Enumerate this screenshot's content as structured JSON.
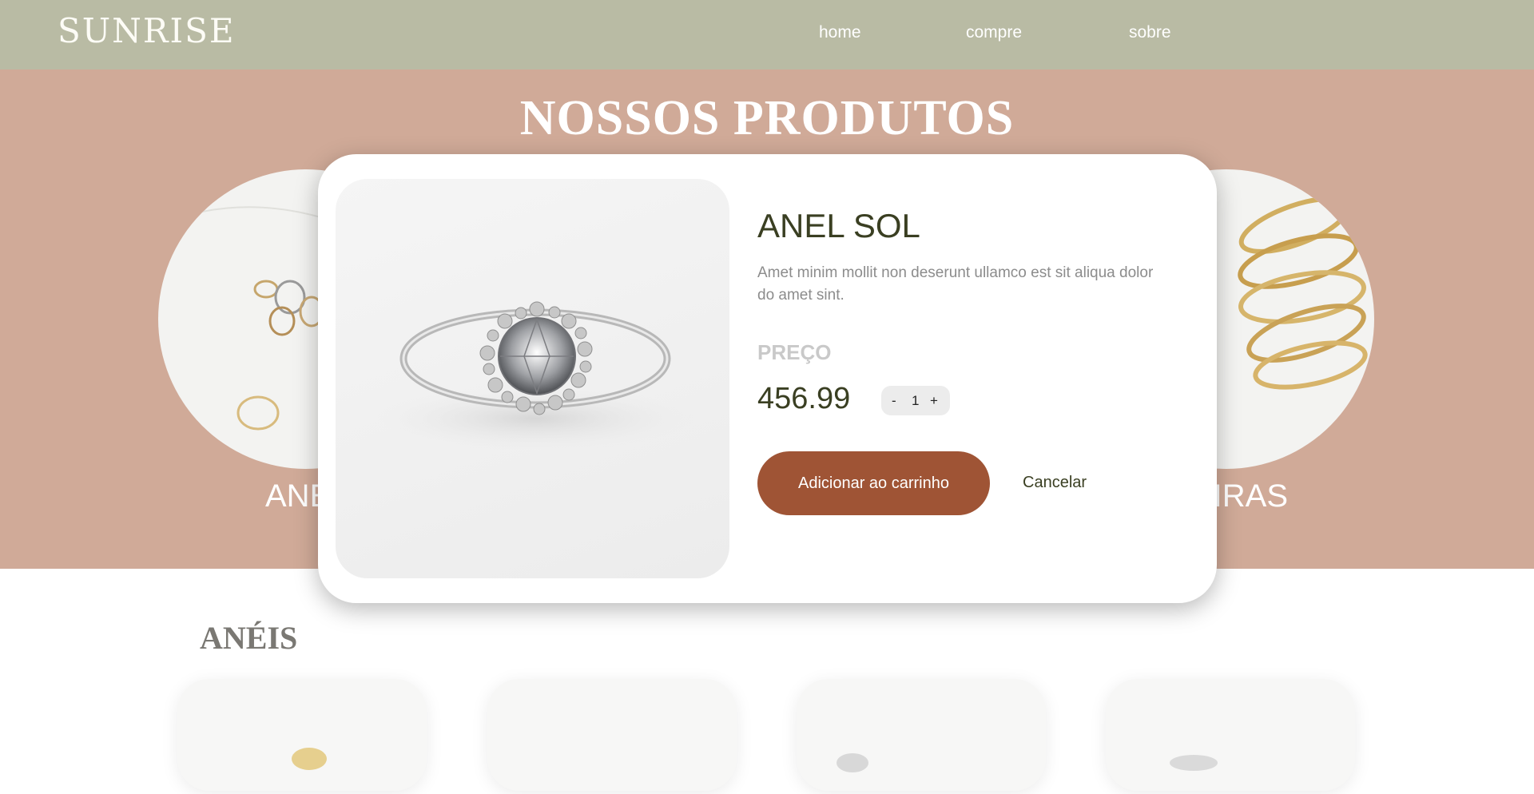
{
  "navbar": {
    "logo": "SUNRISE",
    "links": [
      "home",
      "compre",
      "sobre"
    ]
  },
  "hero": {
    "title": "NOSSOS PRODUTOS",
    "categories": [
      {
        "label": "ANÉ"
      },
      {
        "label": "EIRAS"
      }
    ]
  },
  "section": {
    "title": "ANÉIS"
  },
  "modal": {
    "title": "ANEL SOL",
    "description": "Amet minim mollit non deserunt ullamco est sit aliqua dolor do amet sint.",
    "price_label": "PREÇO",
    "price": "456.99",
    "quantity": "1",
    "decrement": "-",
    "increment": "+",
    "add_to_cart": "Adicionar ao carrinho",
    "cancel": "Cancelar"
  },
  "colors": {
    "navbar": "#b9bba4",
    "hero": "#d0aa98",
    "accent": "#9f5435",
    "text_dark": "#3a3f22"
  }
}
